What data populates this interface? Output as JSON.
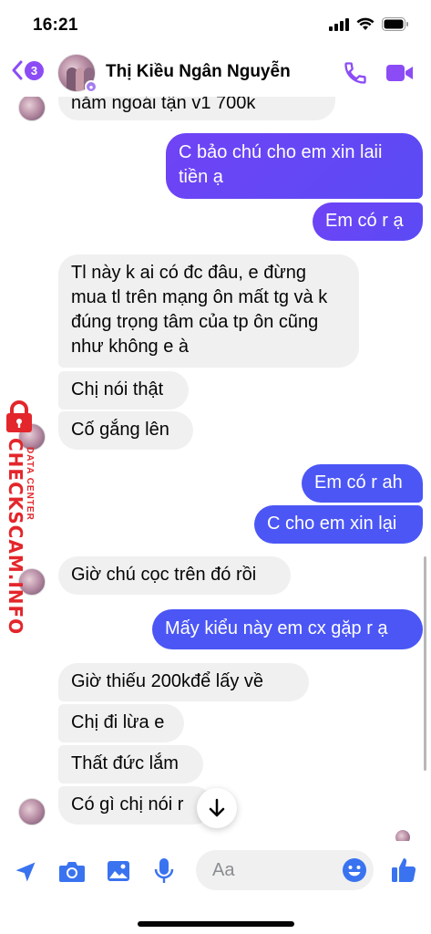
{
  "status_bar": {
    "time": "16:21"
  },
  "header": {
    "back_count": "3",
    "contact_name": "Thị Kiều Ngân Nguyễn",
    "accent_color": "#8c4cf5"
  },
  "messages": [
    {
      "dir": "in",
      "text": "năm ngoái tận v1 700k"
    },
    {
      "dir": "out",
      "text": "C bảo chú cho em xin laii tiền ạ"
    },
    {
      "dir": "out",
      "text": "Em có r ạ"
    },
    {
      "dir": "in",
      "text": "Tl này k ai có đc đâu, e đừng mua tl trên mạng ôn mất tg và k đúng trọng tâm của tp ôn cũng như không e à"
    },
    {
      "dir": "in",
      "text": "Chị nói thật"
    },
    {
      "dir": "in",
      "text": "Cố gắng lên"
    },
    {
      "dir": "out",
      "text": "Em có r ah"
    },
    {
      "dir": "out",
      "text": "C cho em xin lại"
    },
    {
      "dir": "in",
      "text": "Giờ chú cọc trên đó rồi"
    },
    {
      "dir": "out",
      "text": "Mấy kiểu này em cx gặp r ạ"
    },
    {
      "dir": "in",
      "text": "Giờ thiếu 200kđể lấy về"
    },
    {
      "dir": "in",
      "text": "Chị đi lừa e"
    },
    {
      "dir": "in",
      "text": "Thất đức lắm"
    },
    {
      "dir": "in",
      "text": "Có gì chị nói r"
    }
  ],
  "watermark": {
    "main": "CHECKSCAM.INFO",
    "sub": "DATA CENTER"
  },
  "composer": {
    "placeholder": "Aa",
    "icons": [
      "location-arrow-icon",
      "camera-icon",
      "image-icon",
      "microphone-icon",
      "emoji-icon",
      "thumbs-up-icon"
    ]
  }
}
